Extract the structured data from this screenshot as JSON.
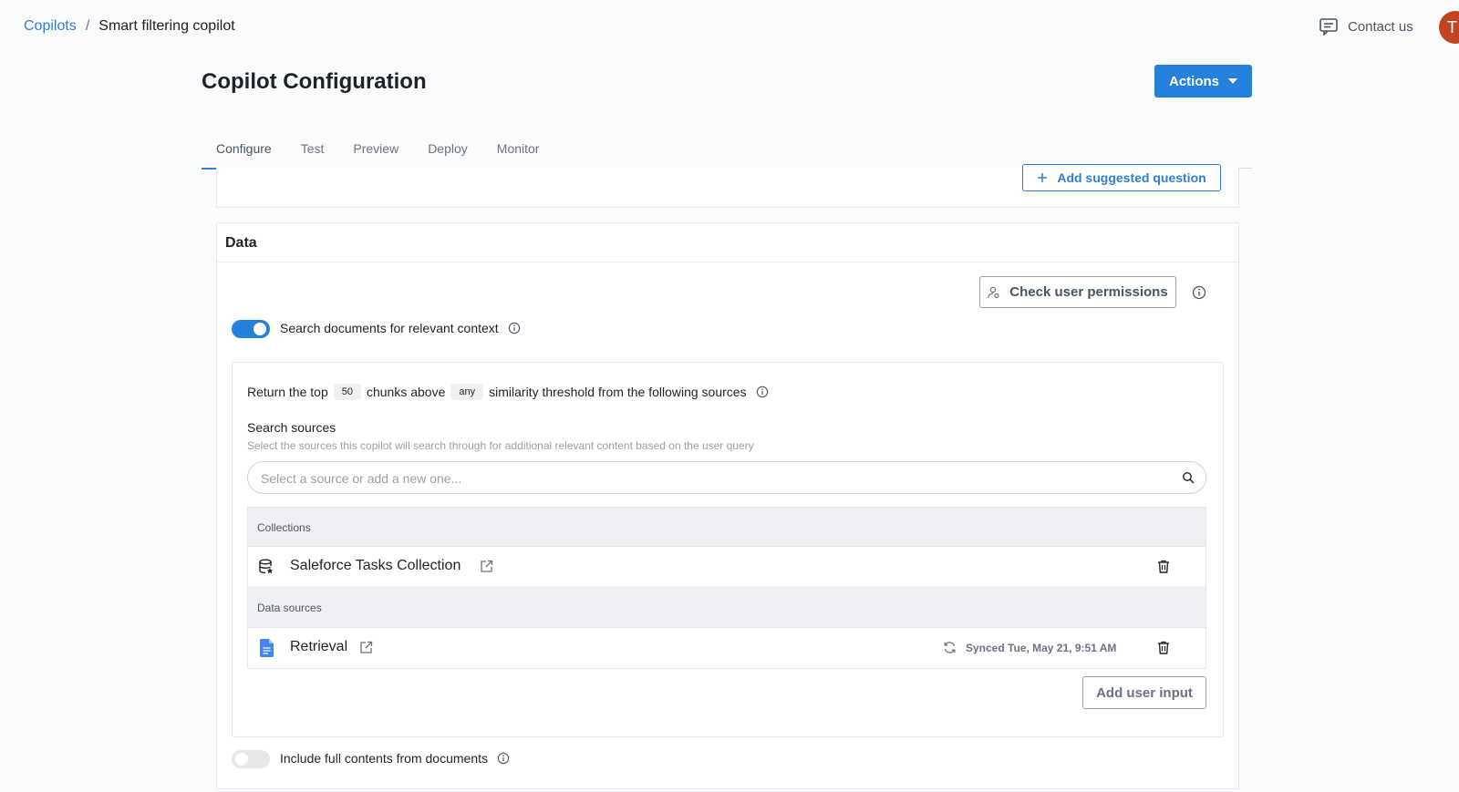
{
  "breadcrumb": {
    "root": "Copilots",
    "separator": "/",
    "current": "Smart filtering copilot"
  },
  "header": {
    "contact_label": "Contact us",
    "avatar_initial": "T"
  },
  "page": {
    "title": "Copilot Configuration",
    "actions_label": "Actions"
  },
  "tabs": [
    {
      "label": "Configure",
      "active": true
    },
    {
      "label": "Test"
    },
    {
      "label": "Preview"
    },
    {
      "label": "Deploy"
    },
    {
      "label": "Monitor"
    }
  ],
  "suggested": {
    "add_label": "Add suggested question"
  },
  "data_section": {
    "title": "Data",
    "check_permissions_label": "Check user permissions",
    "search_docs_label": "Search documents for relevant context",
    "search_docs_enabled": true,
    "return_prefix": "Return the top",
    "chunks_value": "50",
    "return_middle": "chunks above",
    "threshold_value": "any",
    "return_suffix": "similarity threshold from the following sources",
    "search_sources_title": "Search sources",
    "search_sources_sub": "Select the sources this copilot will search through for additional relevant content based on the user query",
    "search_placeholder": "Select a source or add a new one...",
    "collections_header": "Collections",
    "collection_item": "Saleforce Tasks Collection",
    "data_sources_header": "Data sources",
    "data_source_item": "Retrieval",
    "synced_text": "Synced Tue, May 21, 9:51 AM",
    "add_user_input_label": "Add user input",
    "full_contents_label": "Include full contents from documents",
    "full_contents_enabled": false
  },
  "colors": {
    "accent": "#2481db",
    "link": "#2f7fd4",
    "avatar": "#c2431f"
  }
}
